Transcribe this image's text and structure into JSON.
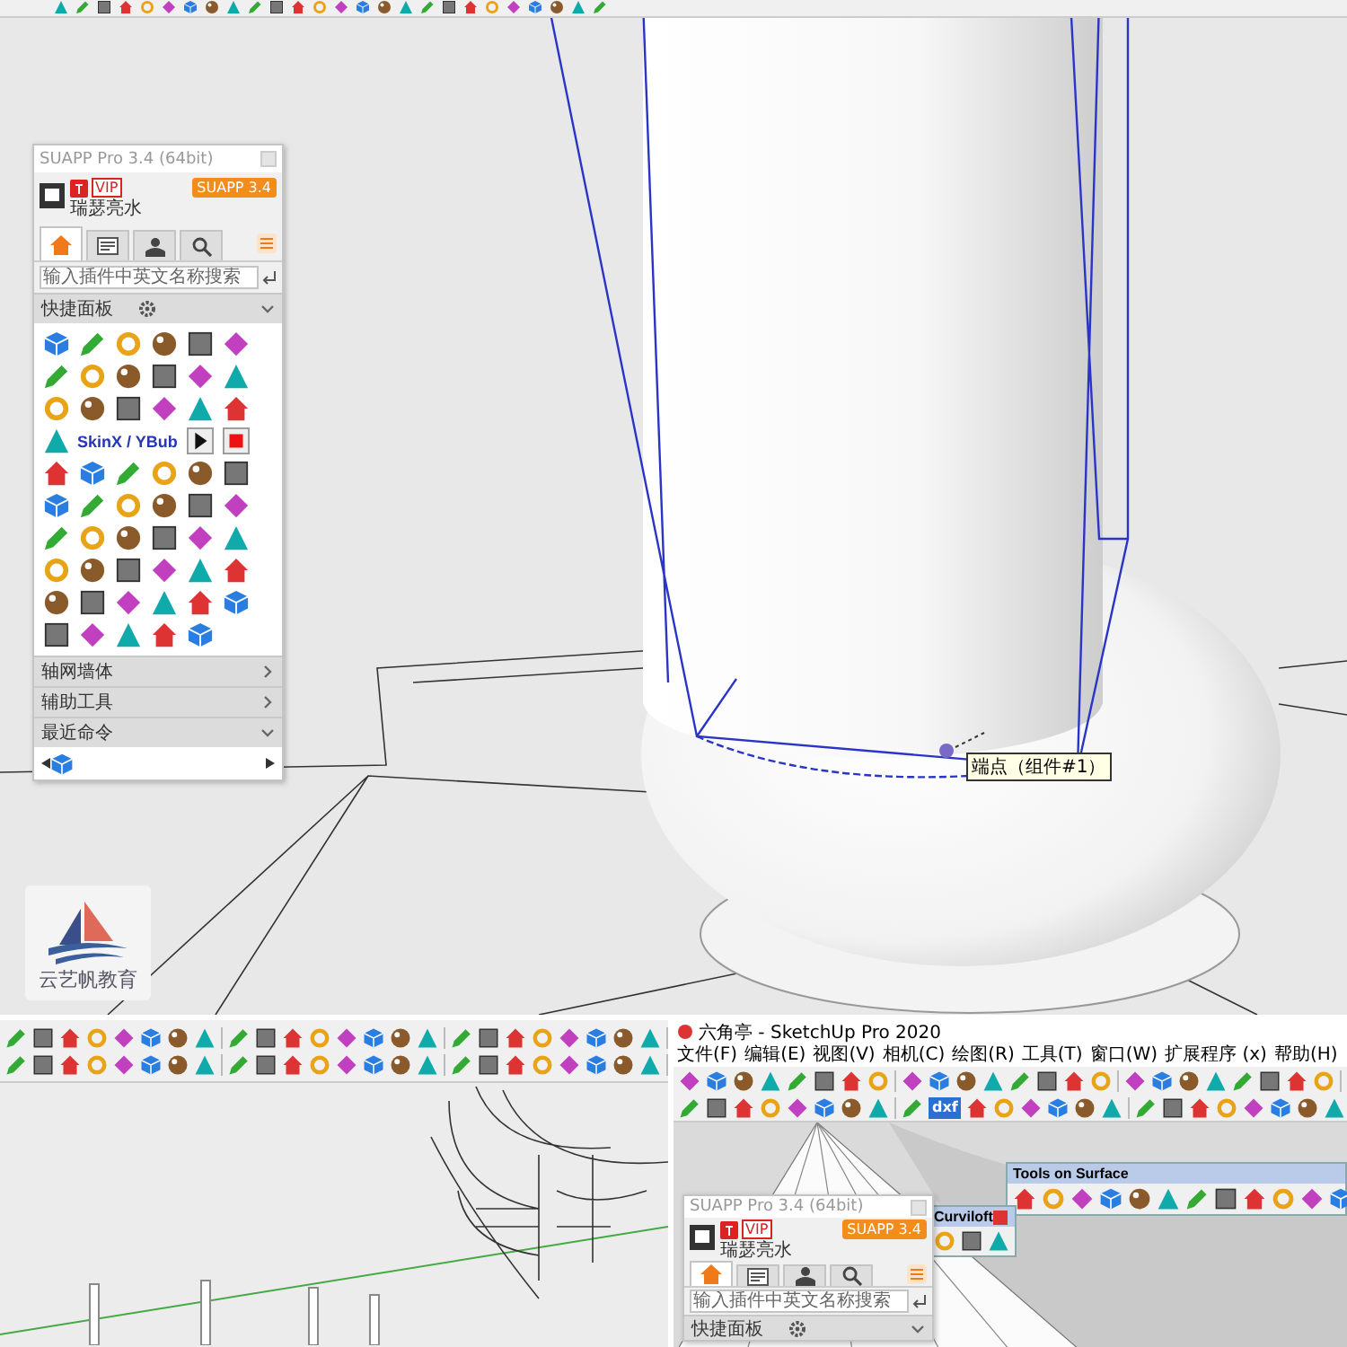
{
  "main_view": {
    "suapp_panel": {
      "title": "SUAPP Pro 3.4 (64bit)",
      "vip_badge": "VIP",
      "version_badge": "SUAPP 3.4",
      "user_name": "瑞瑟亮水",
      "tabs": [
        {
          "selected": true
        },
        {
          "selected": false
        },
        {
          "selected": false
        },
        {
          "selected": false
        }
      ],
      "search": {
        "placeholder": "输入插件中英文名称搜索"
      },
      "sections": [
        {
          "kind": "palette",
          "label": "快捷面板",
          "expanded": true
        },
        {
          "kind": "list",
          "label": "轴网墙体",
          "expanded": false
        },
        {
          "kind": "list",
          "label": "辅助工具",
          "expanded": false
        },
        {
          "kind": "recent",
          "label": "最近命令",
          "expanded": true
        }
      ],
      "palette_label": "SkinX / YBub"
    },
    "tooltip": "端点（组件#1）",
    "logo": {
      "text": "云艺帆教育"
    }
  },
  "sketchup_window": {
    "title": "六角亭 - SketchUp Pro 2020",
    "menu": [
      "文件(F)",
      "编辑(E)",
      "视图(V)",
      "相机(C)",
      "绘图(R)",
      "工具(T)",
      "窗口(W)",
      "扩展程序 (x)",
      "帮助(H)"
    ],
    "toolbar_text": "dxf",
    "tools_on_surface": {
      "title": "Tools on Surface"
    },
    "curviloft": {
      "title": "Curviloft"
    },
    "suapp_panel": {
      "title": "SUAPP Pro 3.4 (64bit)",
      "vip_badge": "VIP",
      "version_badge": "SUAPP 3.4",
      "user_name": "瑞瑟亮水",
      "tabs": [
        {
          "selected": true
        },
        {
          "selected": false
        },
        {
          "selected": false
        },
        {
          "selected": false
        }
      ],
      "search": {
        "placeholder": "输入插件中英文名称搜索"
      },
      "sections": [
        {
          "kind": "palette",
          "label": "快捷面板",
          "expanded": true
        }
      ]
    }
  }
}
